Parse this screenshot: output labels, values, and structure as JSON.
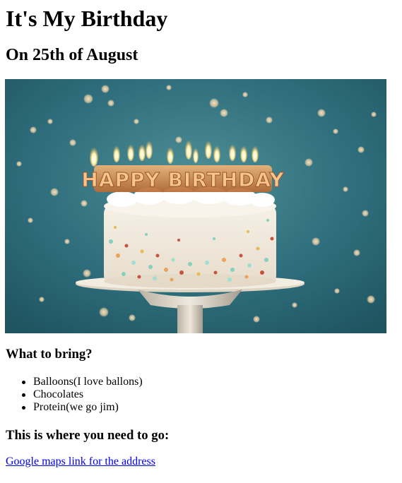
{
  "page": {
    "title": "It's My Birthday",
    "subtitle": "On 25th of August"
  },
  "image": {
    "alt": "Birthday cake with Happy Birthday candles",
    "candles_text": "HAPPY BIRTHDAY"
  },
  "bring": {
    "heading": "What to bring?",
    "items": [
      "Balloons(I love ballons)",
      "Chocolates",
      "Protein(we go jim)"
    ]
  },
  "location": {
    "heading": "This is where you need to go:",
    "link_text": "Google maps link for the address"
  },
  "colors": {
    "link": "#0000ee",
    "background_teal": "#2f6f7d",
    "frosting": "#f3ede2",
    "candle_gold": "#d8894a"
  }
}
